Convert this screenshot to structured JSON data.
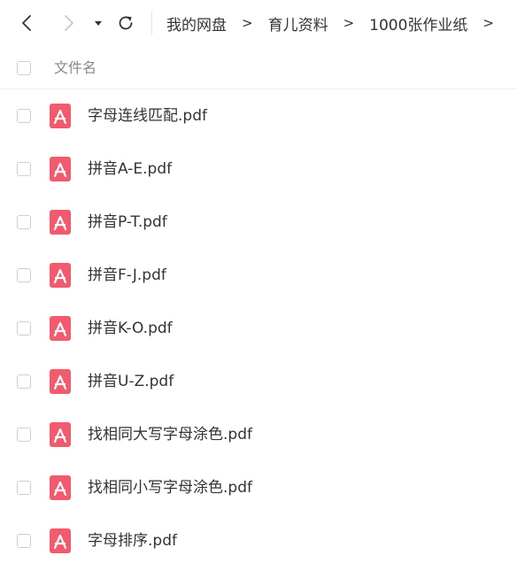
{
  "toolbar": {
    "breadcrumb": [
      "我的网盘",
      "育儿资料",
      "1000张作业纸"
    ],
    "separator": ">"
  },
  "list": {
    "header_label": "文件名",
    "files": [
      {
        "name": "字母连线匹配.pdf",
        "icon": "pdf-icon"
      },
      {
        "name": "拼音A-E.pdf",
        "icon": "pdf-icon"
      },
      {
        "name": "拼音P-T.pdf",
        "icon": "pdf-icon"
      },
      {
        "name": "拼音F-J.pdf",
        "icon": "pdf-icon"
      },
      {
        "name": "拼音K-O.pdf",
        "icon": "pdf-icon"
      },
      {
        "name": "拼音U-Z.pdf",
        "icon": "pdf-icon"
      },
      {
        "name": "找相同大写字母涂色.pdf",
        "icon": "pdf-icon"
      },
      {
        "name": "找相同小写字母涂色.pdf",
        "icon": "pdf-icon"
      },
      {
        "name": "字母排序.pdf",
        "icon": "pdf-icon"
      }
    ]
  },
  "colors": {
    "pdf_icon": "#f25b6e",
    "text": "#333333",
    "muted": "#8a8a8a",
    "disabled": "#c8c8c8"
  }
}
